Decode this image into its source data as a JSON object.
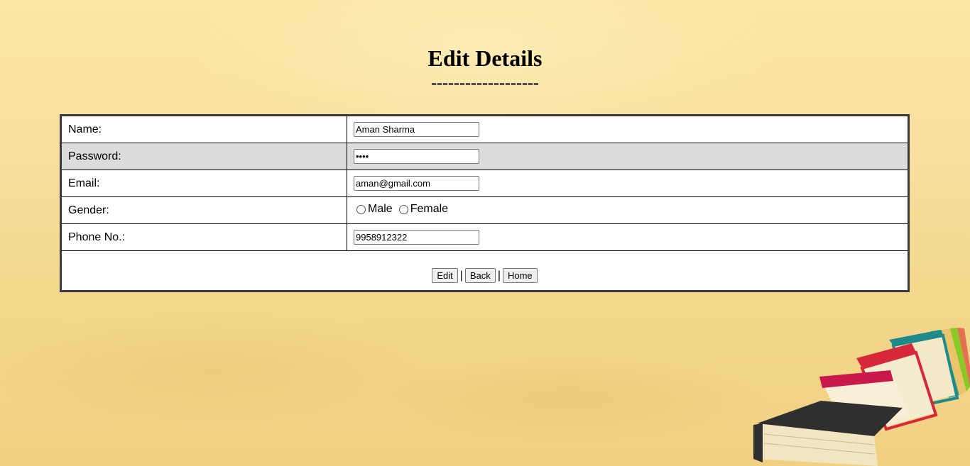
{
  "page": {
    "title": "Edit Details",
    "divider": "-------------------"
  },
  "form": {
    "rows": [
      {
        "label": "Name:",
        "value": "Aman Sharma"
      },
      {
        "label": "Password:",
        "value": "••••"
      },
      {
        "label": "Email:",
        "value": "aman@gmail.com"
      },
      {
        "label": "Gender:",
        "options": [
          "Male",
          "Female"
        ]
      },
      {
        "label": "Phone No.:",
        "value": "9958912322"
      }
    ],
    "buttons": {
      "edit": "Edit",
      "back": "Back",
      "home": "Home",
      "separator": "|"
    }
  },
  "colors": {
    "background": "#f8e0a0",
    "shaded_row": "#dcdcdc",
    "table_border": "#3a3a3a"
  },
  "icons": [
    "books-illustration"
  ]
}
